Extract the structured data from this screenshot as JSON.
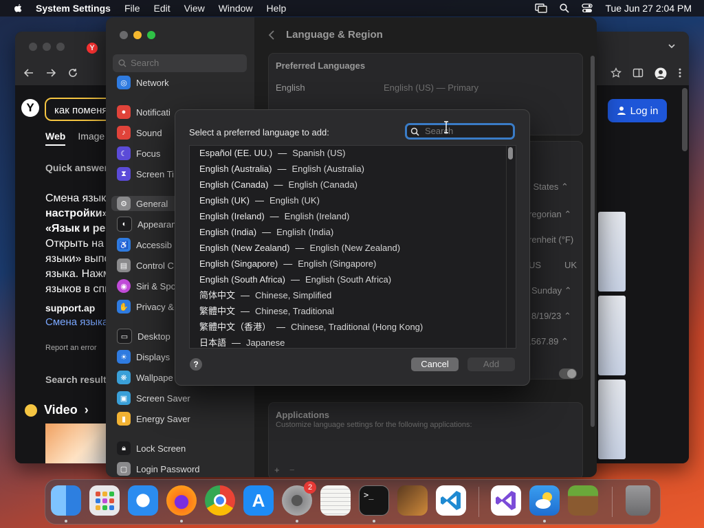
{
  "menubar": {
    "app_name": "System Settings",
    "menus": [
      "File",
      "Edit",
      "View",
      "Window",
      "Help"
    ],
    "datetime": "Tue Jun 27  2:04 PM"
  },
  "browser": {
    "search_query": "как поменя",
    "tabs": {
      "web": "Web",
      "images": "Image"
    },
    "quick_answer": "Quick answer",
    "answer_lines": [
      "Смена язык",
      "настройки»",
      "«Язык и рег",
      "Открыть на",
      "языки» выпо",
      "языка. Нажм",
      "языков в спи"
    ],
    "source": "support.ap",
    "link": "Смена языка",
    "report": "Report an error",
    "search_results": "Search result",
    "video": "Video",
    "login": "Log in"
  },
  "settings": {
    "sidebar_search_placeholder": "Search",
    "sidebar_items": [
      {
        "label": "Network",
        "icon": "network-icon",
        "color": "#2f7be0"
      },
      {
        "label": "Notificati",
        "icon": "notifications-icon",
        "color": "#e0433a"
      },
      {
        "label": "Sound",
        "icon": "sound-icon",
        "color": "#e0433a"
      },
      {
        "label": "Focus",
        "icon": "focus-icon",
        "color": "#5b4bd8"
      },
      {
        "label": "Screen Ti",
        "icon": "screen-time-icon",
        "color": "#5b4bd8"
      },
      {
        "label": "General",
        "icon": "general-icon",
        "color": "#8a8a8c"
      },
      {
        "label": "Appearan",
        "icon": "appearance-icon",
        "color": "#1c1c1e"
      },
      {
        "label": "Accessib",
        "icon": "accessibility-icon",
        "color": "#2f7be0"
      },
      {
        "label": "Control C",
        "icon": "control-center-icon",
        "color": "#8a8a8c"
      },
      {
        "label": "Siri & Spo",
        "icon": "siri-icon",
        "color": "#c04bd8"
      },
      {
        "label": "Privacy &",
        "icon": "privacy-icon",
        "color": "#2f7be0"
      },
      {
        "label": "Desktop",
        "icon": "desktop-dock-icon",
        "color": "#1c1c1e"
      },
      {
        "label": "Displays",
        "icon": "displays-icon",
        "color": "#2f7be0"
      },
      {
        "label": "Wallpape",
        "icon": "wallpaper-icon",
        "color": "#3aa0d8"
      },
      {
        "label": "Screen Saver",
        "icon": "screen-saver-icon",
        "color": "#3aa0d8"
      },
      {
        "label": "Energy Saver",
        "icon": "energy-saver-icon",
        "color": "#f2b233"
      },
      {
        "label": "Lock Screen",
        "icon": "lock-screen-icon",
        "color": "#1c1c1e"
      },
      {
        "label": "Login Password",
        "icon": "login-password-icon",
        "color": "#8a8a8c"
      }
    ],
    "page_title": "Language & Region",
    "preferred_languages_title": "Preferred Languages",
    "preferred_language": {
      "name": "English",
      "detail": "English (US) — Primary"
    },
    "region_partial": "l States",
    "calendar_partial": "regorian",
    "temperature_partial": "renheit (°F)",
    "measurement_us": "US",
    "measurement_uk": "UK",
    "first_day_partial": "Sunday",
    "date_partial": "8/19/23",
    "number_partial": ",567.89",
    "applications_title": "Applications",
    "applications_desc": "Customize language settings for the following applications:",
    "add_remove": [
      "+",
      "−"
    ]
  },
  "modal": {
    "prompt": "Select a preferred language to add:",
    "search_placeholder": "Search",
    "separator": "—",
    "languages": [
      {
        "native": "Español (EE. UU.)",
        "english": "Spanish (US)"
      },
      {
        "native": "English (Australia)",
        "english": "English (Australia)"
      },
      {
        "native": "English (Canada)",
        "english": "English (Canada)"
      },
      {
        "native": "English (UK)",
        "english": "English (UK)"
      },
      {
        "native": "English (Ireland)",
        "english": "English (Ireland)"
      },
      {
        "native": "English (India)",
        "english": "English (India)"
      },
      {
        "native": "English (New Zealand)",
        "english": "English (New Zealand)"
      },
      {
        "native": "English (Singapore)",
        "english": "English (Singapore)"
      },
      {
        "native": "English (South Africa)",
        "english": "English (South Africa)"
      },
      {
        "native": "简体中文",
        "english": "Chinese, Simplified"
      },
      {
        "native": "繁體中文",
        "english": "Chinese, Traditional"
      },
      {
        "native": "繁體中文（香港）",
        "english": "Chinese, Traditional (Hong Kong)"
      },
      {
        "native": "日本語",
        "english": "Japanese"
      }
    ],
    "help": "?",
    "cancel": "Cancel",
    "add": "Add"
  },
  "dock": {
    "apps": [
      {
        "name": "finder-icon",
        "color": "#3a8ee6"
      },
      {
        "name": "launchpad-icon",
        "color": "#e8e8ea"
      },
      {
        "name": "safari-icon",
        "color": "#2b8cf0"
      },
      {
        "name": "firefox-icon",
        "color": "#ff7a1a"
      },
      {
        "name": "chrome-icon",
        "color": "#ffffff"
      },
      {
        "name": "app-store-icon",
        "color": "#1e8cf5"
      },
      {
        "name": "system-settings-icon",
        "color": "#7a7a7c"
      },
      {
        "name": "textedit-icon",
        "color": "#f5f5f2"
      },
      {
        "name": "terminal-icon",
        "color": "#151515"
      },
      {
        "name": "garageband-icon",
        "color": "#3a2a1e"
      },
      {
        "name": "vscode-icon",
        "color": "#ffffff"
      },
      {
        "name": "visual-studio-icon",
        "color": "#ffffff"
      },
      {
        "name": "weather-icon",
        "color": "#2f8ce0"
      },
      {
        "name": "minecraft-icon",
        "color": "#4f8a2a"
      },
      {
        "name": "trash-icon",
        "color": "#8a8a8c"
      }
    ],
    "settings_badge": "2"
  }
}
